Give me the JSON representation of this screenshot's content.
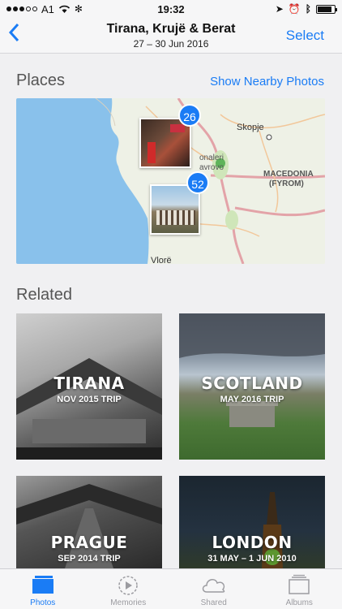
{
  "status_bar": {
    "carrier": "A1",
    "time": "19:32",
    "battery_level": 0.85
  },
  "nav": {
    "back_icon": "chevron-left-icon",
    "title": "Tirana, Krujë & Berat",
    "subtitle": "27 – 30 Jun 2016",
    "select_label": "Select"
  },
  "places": {
    "heading": "Places",
    "nearby_label": "Show Nearby Photos",
    "map_labels": {
      "skopje": "Skopje",
      "macedonia": "MACEDONIA",
      "fyrom": "(FYROM)",
      "vlore": "Vlorë",
      "park1": "onaleri",
      "park2": "avrovo"
    },
    "clusters": [
      {
        "count": "26"
      },
      {
        "count": "52"
      }
    ]
  },
  "related": {
    "heading": "Related",
    "items": [
      {
        "title": "TIRANA",
        "subtitle": "NOV 2015 TRIP"
      },
      {
        "title": "SCOTLAND",
        "subtitle": "MAY 2016 TRIP"
      },
      {
        "title": "PRAGUE",
        "subtitle": "SEP 2014 TRIP"
      },
      {
        "title": "LONDON",
        "subtitle": "31 MAY – 1 JUN 2010"
      }
    ]
  },
  "tabbar": {
    "tabs": [
      {
        "label": "Photos",
        "icon": "photos-icon",
        "active": true
      },
      {
        "label": "Memories",
        "icon": "memories-icon",
        "active": false
      },
      {
        "label": "Shared",
        "icon": "cloud-icon",
        "active": false
      },
      {
        "label": "Albums",
        "icon": "albums-icon",
        "active": false
      }
    ]
  },
  "colors": {
    "accent": "#1a7cf5",
    "inactive_tab": "#9b9ba0",
    "sea": "#89c1eb"
  }
}
